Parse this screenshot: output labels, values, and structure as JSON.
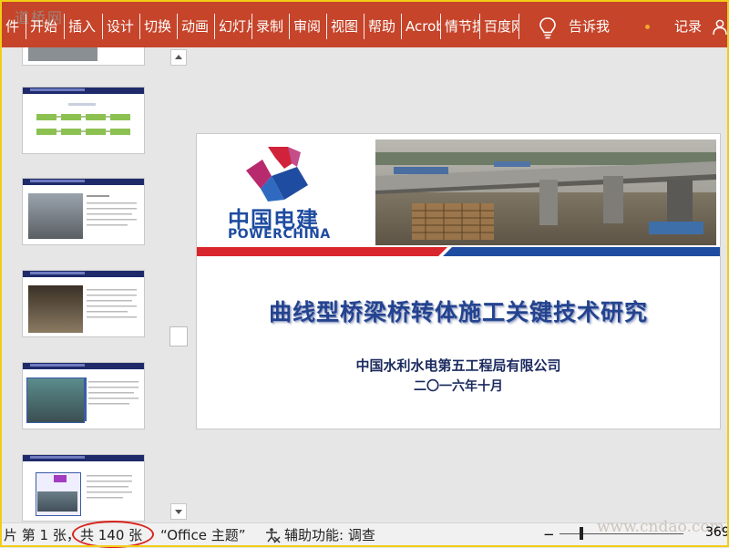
{
  "watermark_top": "道桥网",
  "ribbon": {
    "tabs": [
      "件",
      "开始",
      "插入",
      "设计",
      "切换",
      "动画",
      "幻灯片放映",
      "录制",
      "审阅",
      "视图",
      "帮助",
      "Acrobat",
      "情节提要",
      "百度网盘"
    ],
    "tell_me": "告诉我",
    "record": "记录",
    "colors": {
      "background": "#c5442a",
      "text": "#ffffff"
    }
  },
  "slide": {
    "logo_cn": "中国电建",
    "logo_en": "POWERCHINA",
    "title": "曲线型桥梁桥转体施工关键技术研究",
    "company": "中国水利水电第五工程局有限公司",
    "date": "二〇一六年十月",
    "colors": {
      "title": "#24438f",
      "stripe_red": "#d8262c",
      "stripe_blue": "#1e4ca0"
    }
  },
  "status": {
    "slide_pos": "片 第 1 张，",
    "total": "共 140 张",
    "theme": "“Office 主题”",
    "accessibility": "辅助功能: 调查",
    "zoom_minus": "−",
    "zoom": "369",
    "corner_watermark": "www.cndao.com"
  },
  "icons": [
    "lightbulb-icon",
    "share-person-icon",
    "scroll-up-icon",
    "scroll-down-icon",
    "accessibility-icon"
  ]
}
